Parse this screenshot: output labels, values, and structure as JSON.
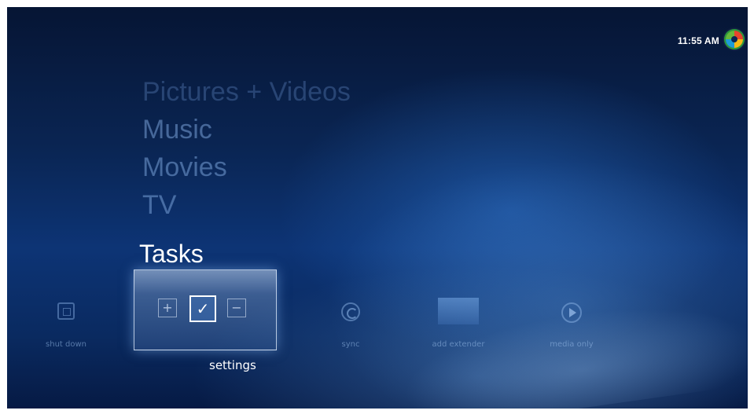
{
  "clock": {
    "time": "11:55 AM"
  },
  "menu": {
    "items": [
      {
        "label": "Pictures + Videos"
      },
      {
        "label": "Music"
      },
      {
        "label": "Movies"
      },
      {
        "label": "TV"
      }
    ],
    "current": "Tasks"
  },
  "tasks": [
    {
      "label": "shut down",
      "icon": "power-icon"
    },
    {
      "label": "settings",
      "icon": "checkbox-icon",
      "selected": true
    },
    {
      "label": "sync",
      "icon": "sync-icon"
    },
    {
      "label": "add extender",
      "icon": "extender-icon"
    },
    {
      "label": "media only",
      "icon": "media-only-icon"
    }
  ],
  "settings_controls": {
    "plus": "+",
    "check": "✓",
    "minus": "−"
  },
  "colors": {
    "accent": "#0d3475",
    "highlight": "#ffffff"
  }
}
